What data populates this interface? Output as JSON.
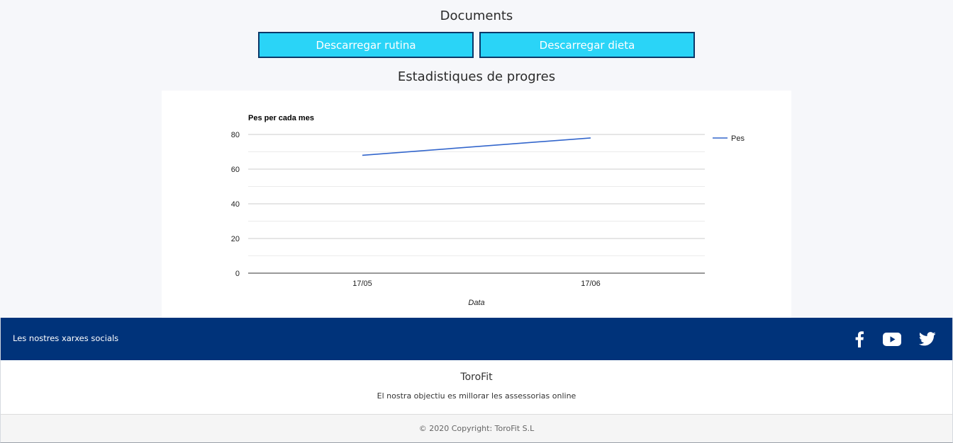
{
  "documents": {
    "title": "Documents",
    "download_routine_label": "Descarregar rutina",
    "download_diet_label": "Descarregar dieta"
  },
  "stats": {
    "title": "Estadistiques de progres"
  },
  "chart_data": {
    "type": "line",
    "title": "Pes per cada mes",
    "xlabel": "Data",
    "ylabel": "",
    "categories": [
      "17/05",
      "17/06"
    ],
    "series": [
      {
        "name": "Pes",
        "values": [
          68,
          78
        ],
        "color": "#3366cc"
      }
    ],
    "ylim": [
      0,
      80
    ],
    "yticks": [
      0,
      20,
      40,
      60,
      80
    ],
    "grid": true,
    "legend": "right"
  },
  "footer": {
    "social_label": "Les nostres xarxes socials",
    "icons": [
      "facebook-icon",
      "youtube-icon",
      "twitter-icon"
    ],
    "background_color": "#00337a",
    "brand_name": "ToroFit",
    "tagline": "El nostra objectiu es millorar les assessorias online",
    "copyright": "© 2020 Copyright: ToroFit S.L"
  },
  "colors": {
    "button_bg": "#2ad4f7",
    "button_border": "#0b3868",
    "line": "#3366cc"
  }
}
